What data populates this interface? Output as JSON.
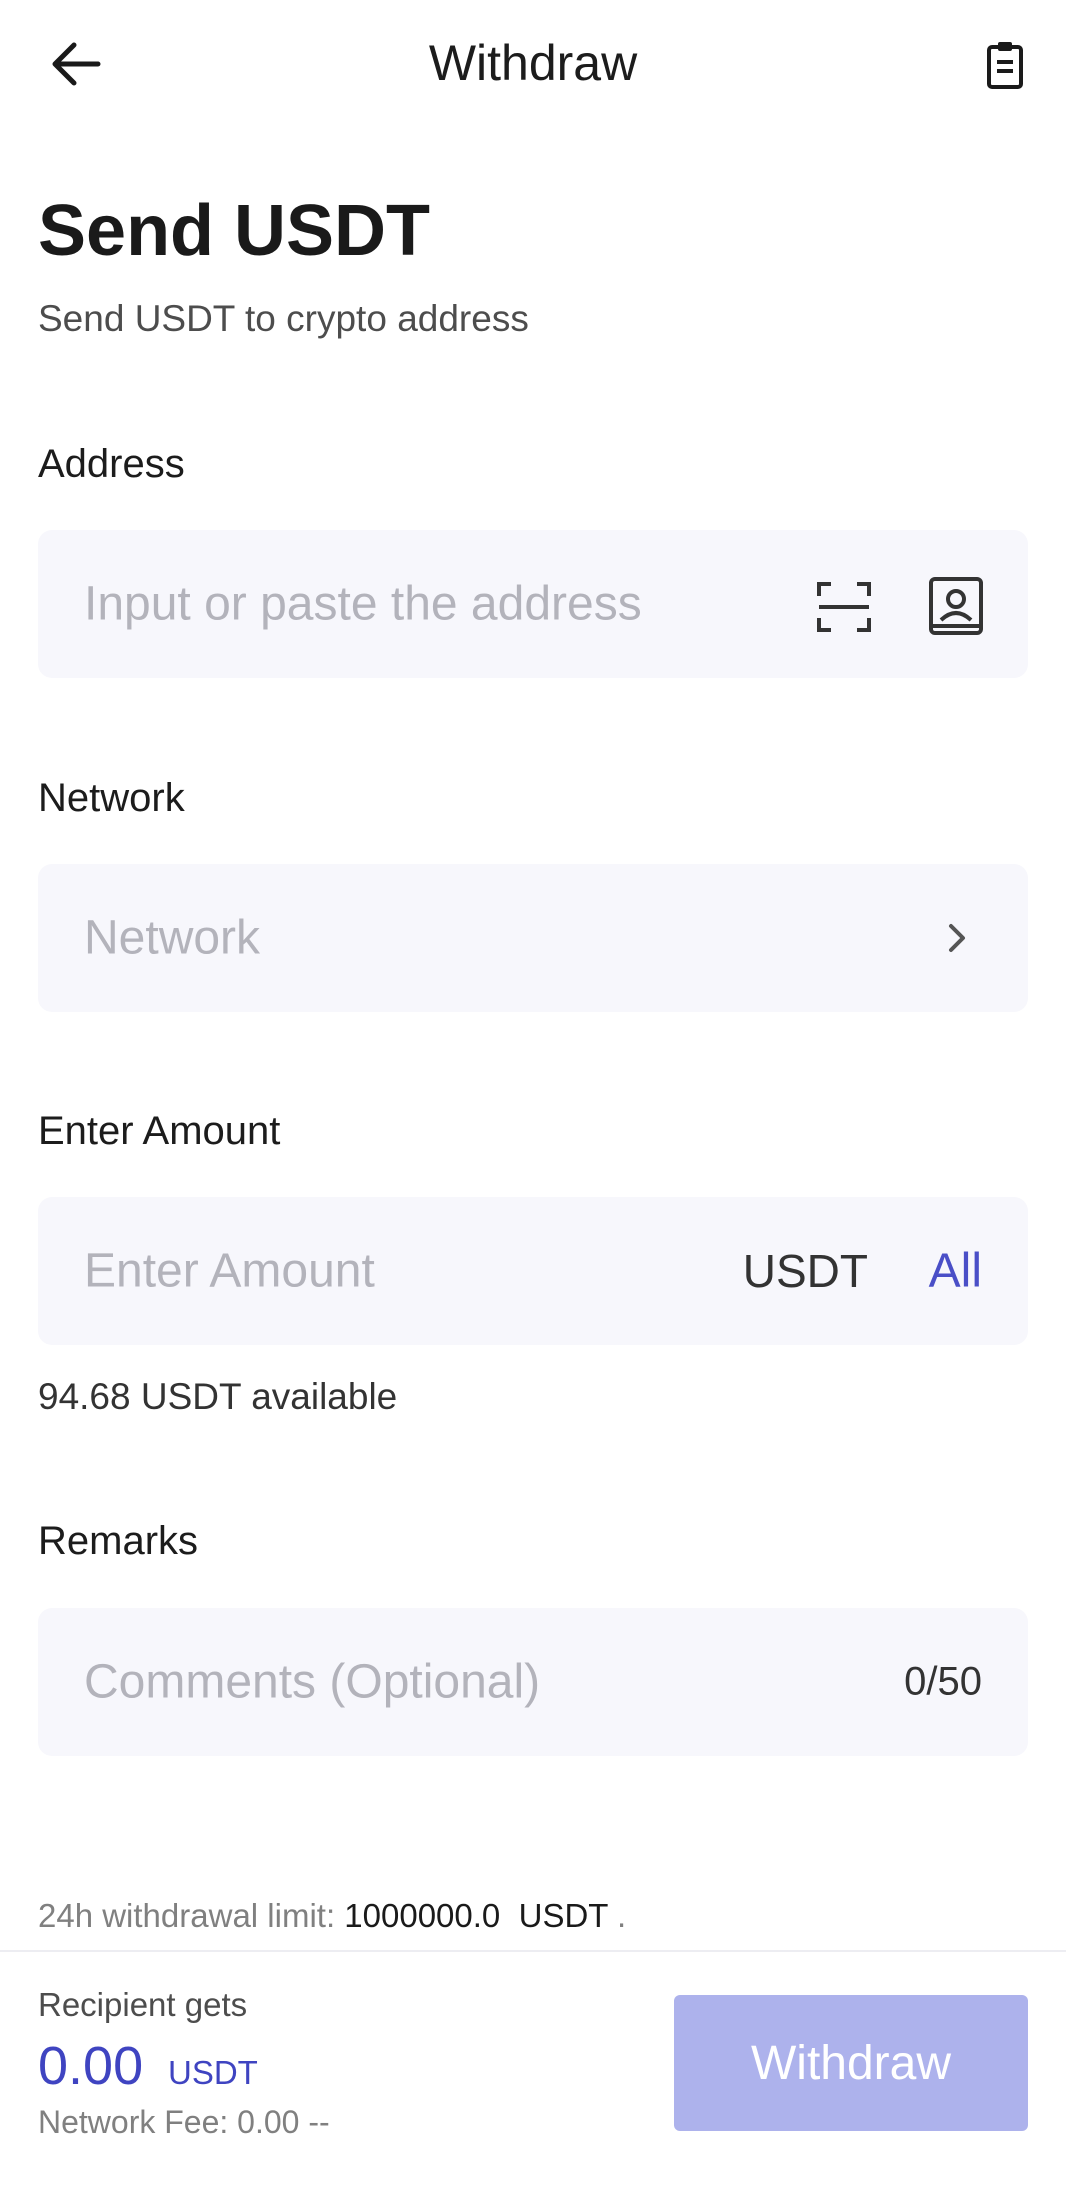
{
  "header": {
    "title": "Withdraw",
    "back_icon": "arrow-left-icon",
    "records_icon": "clipboard-icon"
  },
  "page": {
    "title": "Send USDT",
    "subtitle": "Send USDT to crypto address"
  },
  "address": {
    "label": "Address",
    "placeholder": "Input or paste the address",
    "scan_icon": "scan-icon",
    "contacts_icon": "address-book-icon"
  },
  "network": {
    "label": "Network",
    "placeholder": "Network",
    "chevron_icon": "chevron-right-icon"
  },
  "amount": {
    "label": "Enter Amount",
    "placeholder": "Enter Amount",
    "unit": "USDT",
    "all_label": "All",
    "available_text": "94.68 USDT available"
  },
  "remarks": {
    "label": "Remarks",
    "placeholder": "Comments (Optional)",
    "counter": "0/50"
  },
  "limit": {
    "prefix": "24h withdrawal limit: ",
    "value": "1000000.0",
    "unit": "USDT",
    "suffix": " ."
  },
  "footer": {
    "recipient_label": "Recipient gets",
    "recipient_amount": "0.00",
    "recipient_unit": "USDT",
    "fee_text": "Network Fee: 0.00 --",
    "withdraw_label": "Withdraw"
  },
  "colors": {
    "accent": "#3f44c1",
    "button_disabled": "#adb2ec",
    "field_bg": "#f7f7fc"
  }
}
